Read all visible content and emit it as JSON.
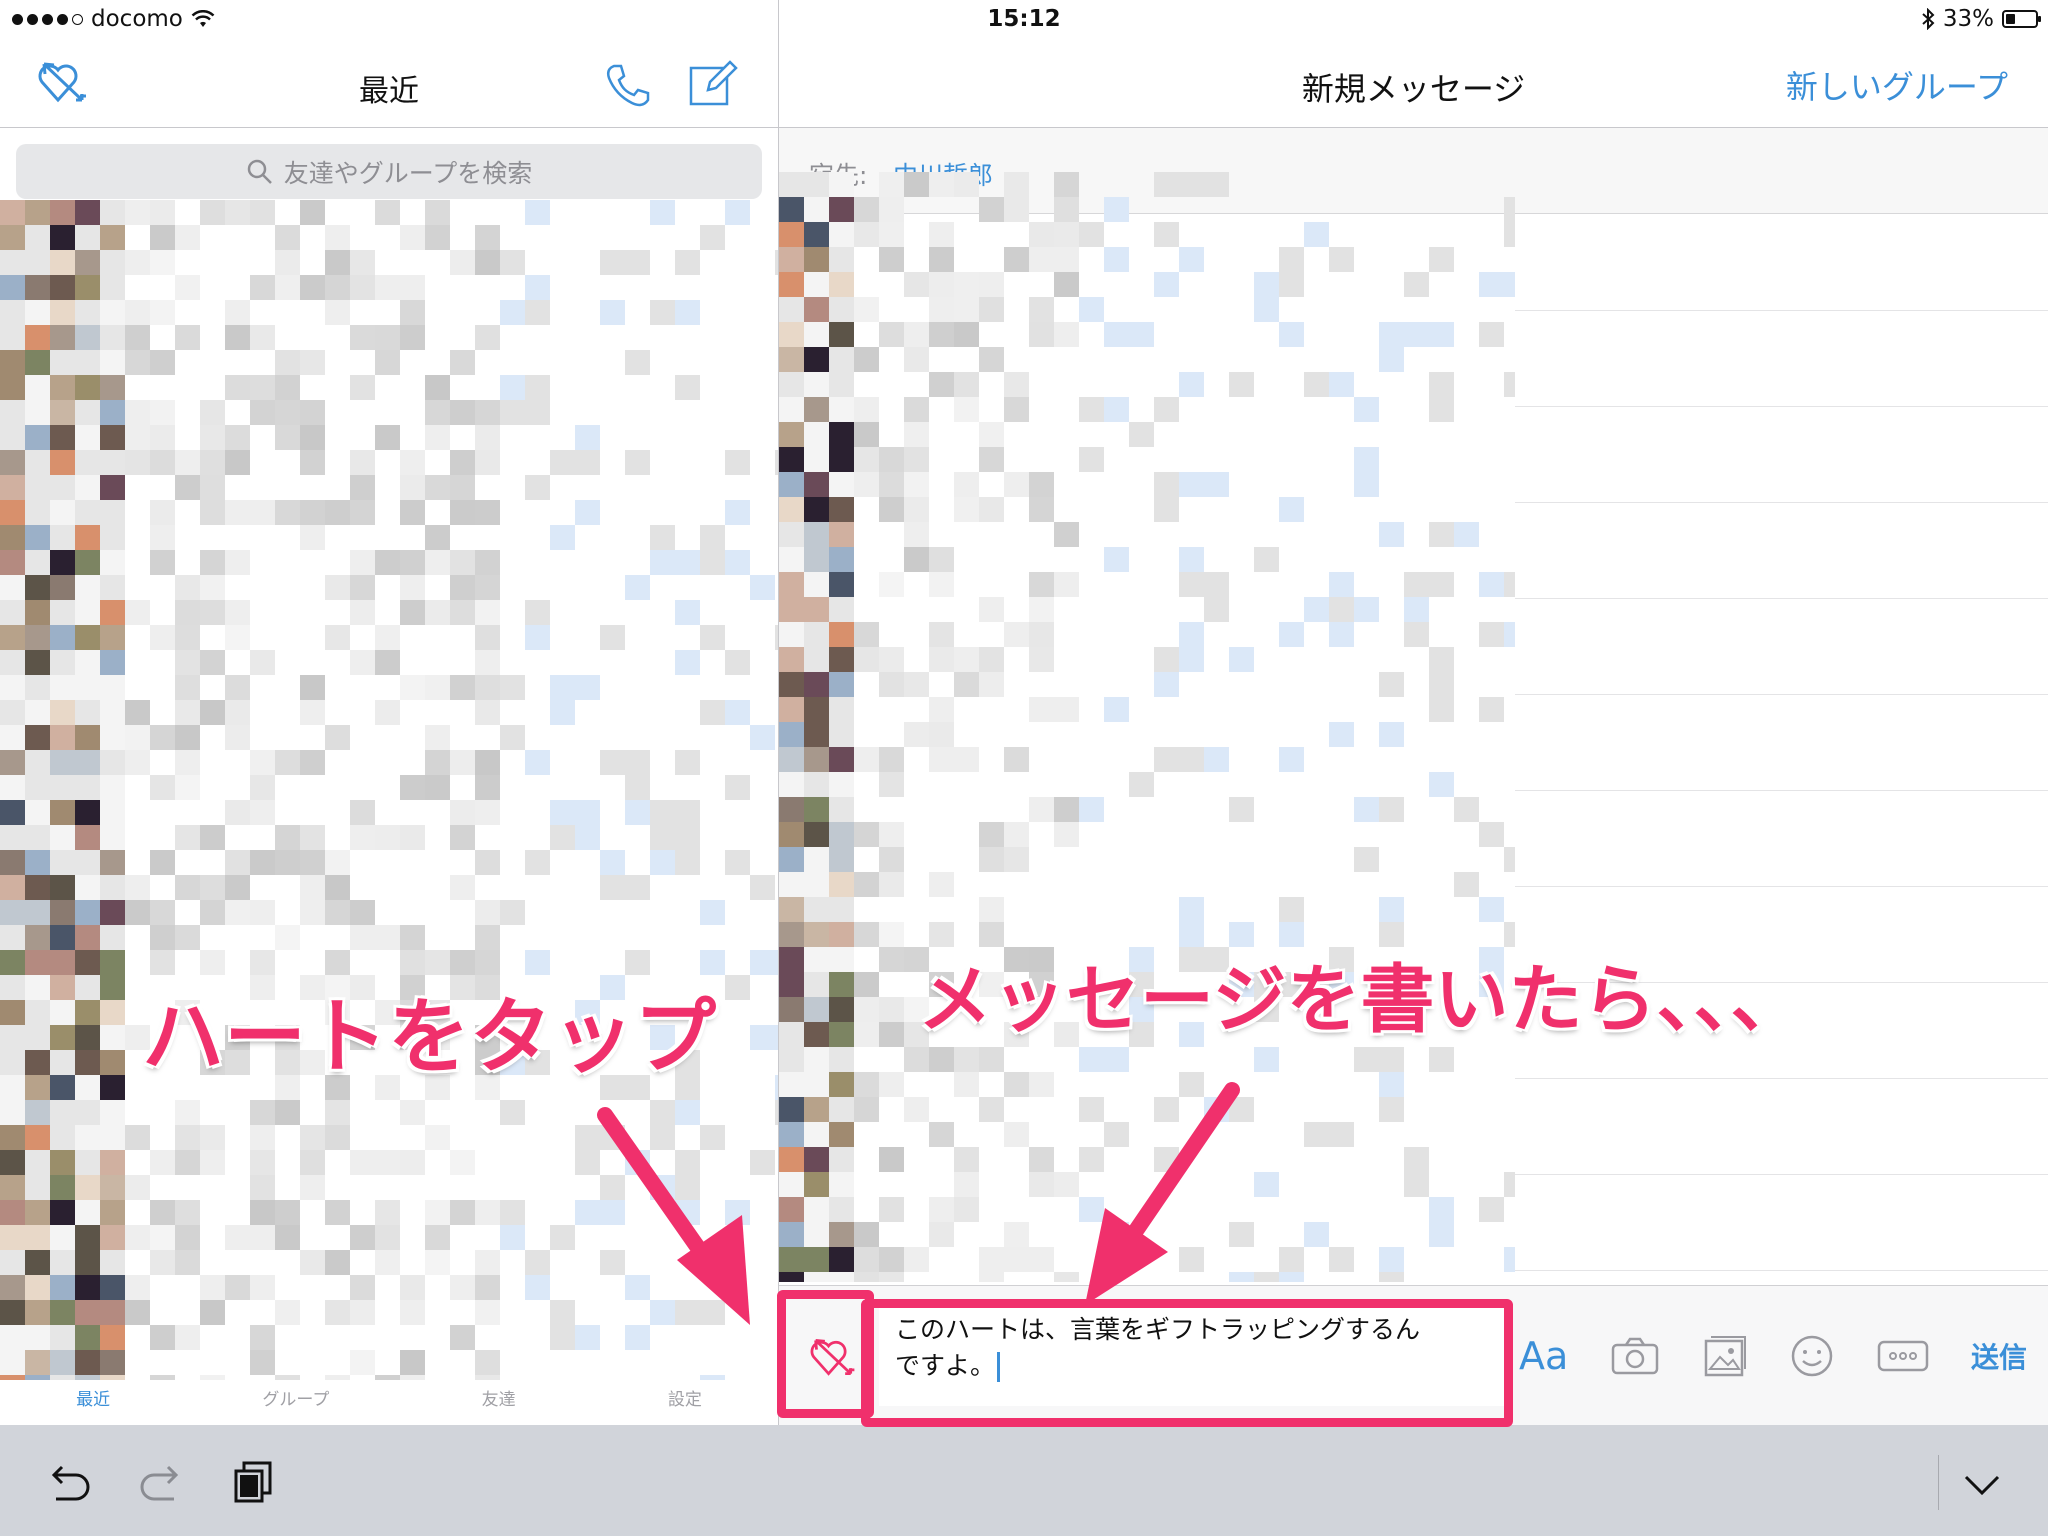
{
  "status_bar": {
    "carrier": "docomo",
    "time": "15:12",
    "battery": "33%",
    "battery_level": 0.33
  },
  "left_pane": {
    "title": "最近",
    "search_placeholder": "友達やグループを検索",
    "tabs": [
      {
        "label": "最近",
        "active": true
      },
      {
        "label": "グループ",
        "active": false
      },
      {
        "label": "友達",
        "active": false
      },
      {
        "label": "設定",
        "active": false
      }
    ]
  },
  "right_pane": {
    "title": "新規メッセージ",
    "new_group": "新しいグループ",
    "to_label": "宛先:",
    "to_name": "中川哲郎"
  },
  "composer": {
    "message_line1": "このハートは、言葉をギフトラッピングするん",
    "message_line2": "ですよ。",
    "font_label": "Aa",
    "send_label": "送信"
  },
  "annotations": {
    "tap_heart": "ハートをタップ",
    "write_message": "メッセージを書いたら、、、"
  },
  "colors": {
    "accent": "#3b8fd8",
    "annotation": "#f0306c",
    "keyboard_bar": "#d1d4da"
  }
}
